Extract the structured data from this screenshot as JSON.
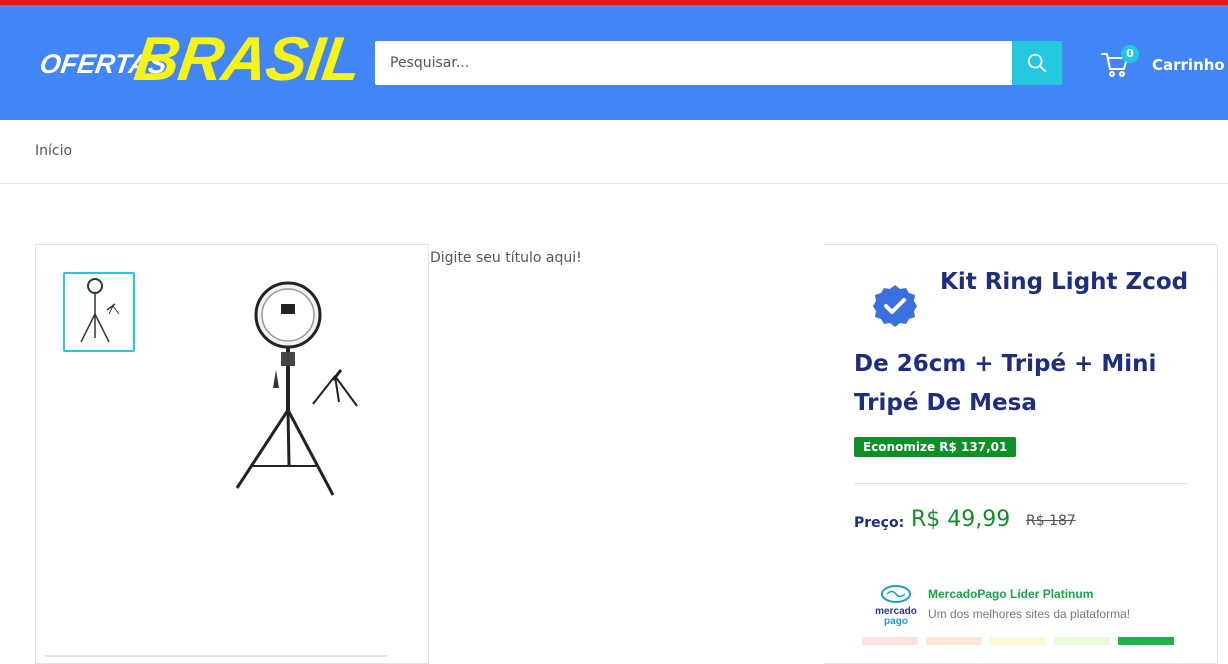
{
  "header": {
    "logo_small": "OFERTAS",
    "logo_big": "BRASIL",
    "search_placeholder": "Pesquisar...",
    "cart_count": "0",
    "cart_label": "Carrinho"
  },
  "breadcrumb": {
    "home": "Início"
  },
  "product": {
    "placeholder_heading": "Digite seu título aqui!",
    "title_line1": "Kit Ring Light Zcod",
    "title_line2": "De 26cm + Tripé + Mini Tripé De Mesa",
    "savings": "Economize R$ 137,01",
    "price_label": "Preço:",
    "price": "R$ 49,99",
    "old_price": "R$ 187"
  },
  "seller": {
    "logo_text_top": "mercado",
    "logo_text_bottom": "pago",
    "title": "MercadoPago Líder Platinum",
    "subtitle": "Um dos melhores sites da plataforma!",
    "meter_colors": [
      "#fde2e2",
      "#fde8da",
      "#fdf8d6",
      "#eef9d8",
      "#22b14c"
    ]
  },
  "colors": {
    "header_bg": "#4285f4",
    "accent": "#25c6df",
    "top_bar": "#e5161a",
    "title": "#1e2d7d",
    "price_green": "#108f29"
  }
}
